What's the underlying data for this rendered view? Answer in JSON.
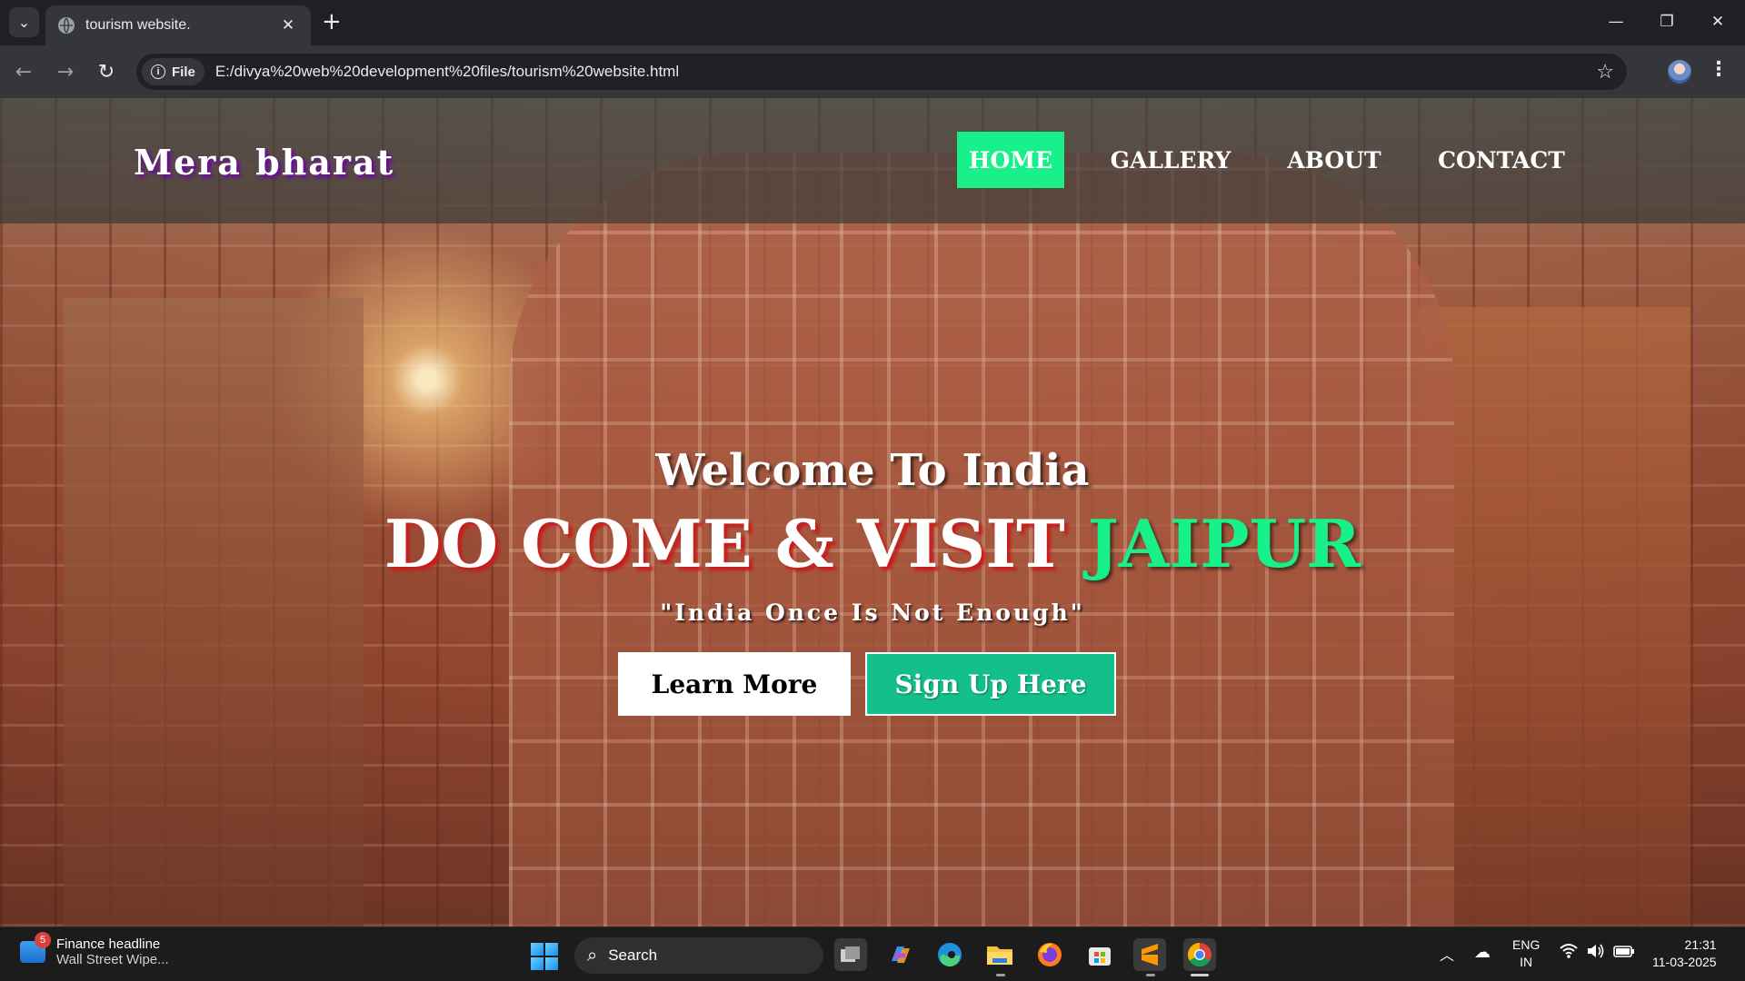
{
  "browser": {
    "tab_title": "tourism website.",
    "new_tab": "+",
    "minimize": "—",
    "restore": "❐",
    "close": "✕",
    "chip_label": "File",
    "url": "E:/divya%20web%20development%20files/tourism%20website.html"
  },
  "site": {
    "logo": "Mera bharat",
    "nav": [
      "HOME",
      "GALLERY",
      "ABOUT",
      "CONTACT"
    ],
    "active_nav": "HOME",
    "welcome": "Welcome To India",
    "headline_main": "DO COME & VISIT ",
    "headline_accent": "JAIPUR",
    "tagline": "\"India Once Is Not Enough\"",
    "learn_more": "Learn More",
    "sign_up": "Sign Up Here",
    "accent_color": "#18f08a",
    "headline_shadow_color": "#c81c1c"
  },
  "taskbar": {
    "news_badge": "5",
    "news_title": "Finance headline",
    "news_subtitle": "Wall Street Wipe...",
    "search_placeholder": "Search",
    "lang_line1": "ENG",
    "lang_line2": "IN",
    "time": "21:31",
    "date": "11-03-2025",
    "icons": [
      "windows-start-icon",
      "search-icon",
      "task-view-icon",
      "copilot-icon",
      "edge-icon",
      "file-explorer-icon",
      "firefox-icon",
      "microsoft-store-icon",
      "sublime-text-icon",
      "chrome-icon",
      "chevron-up-icon",
      "onedrive-icon",
      "wifi-icon",
      "volume-icon",
      "battery-icon"
    ]
  }
}
